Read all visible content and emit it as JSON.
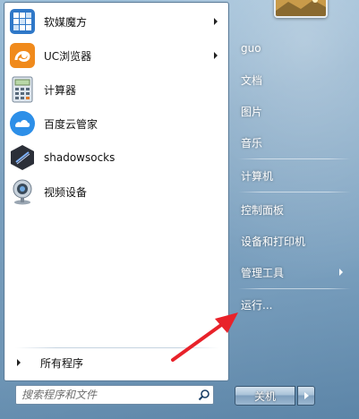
{
  "start_menu": {
    "pinned_programs": [
      {
        "label": "软媒魔方",
        "icon": "rubiks-cube-icon",
        "has_submenu": true
      },
      {
        "label": "UC浏览器",
        "icon": "uc-browser-icon",
        "has_submenu": true
      },
      {
        "label": "计算器",
        "icon": "calculator-icon",
        "has_submenu": false
      },
      {
        "label": "百度云管家",
        "icon": "baidu-cloud-icon",
        "has_submenu": false
      },
      {
        "label": "shadowsocks",
        "icon": "shadowsocks-icon",
        "has_submenu": false
      },
      {
        "label": "视频设备",
        "icon": "webcam-icon",
        "has_submenu": false
      }
    ],
    "all_programs_label": "所有程序",
    "search": {
      "placeholder": "搜索程序和文件",
      "value": "",
      "icon": "search-icon"
    },
    "right_items": [
      {
        "label": "guo",
        "name": "user-folder"
      },
      {
        "label": "文档",
        "name": "documents"
      },
      {
        "label": "图片",
        "name": "pictures"
      },
      {
        "label": "音乐",
        "name": "music"
      },
      {
        "label": "计算机",
        "name": "computer"
      },
      {
        "label": "控制面板",
        "name": "control-panel"
      },
      {
        "label": "设备和打印机",
        "name": "devices-printers"
      },
      {
        "label": "管理工具",
        "name": "admin-tools",
        "has_submenu": true
      },
      {
        "label": "运行...",
        "name": "run"
      }
    ],
    "shutdown": {
      "label": "关机",
      "arrow_icon": "chevron-right-icon"
    },
    "colors": {
      "accent": "#e8222a",
      "pane_border": "#5d7d99",
      "right_text": "#ffffff"
    },
    "annotation": {
      "icon": "red-arrow-icon",
      "points_to": "运行..."
    }
  }
}
